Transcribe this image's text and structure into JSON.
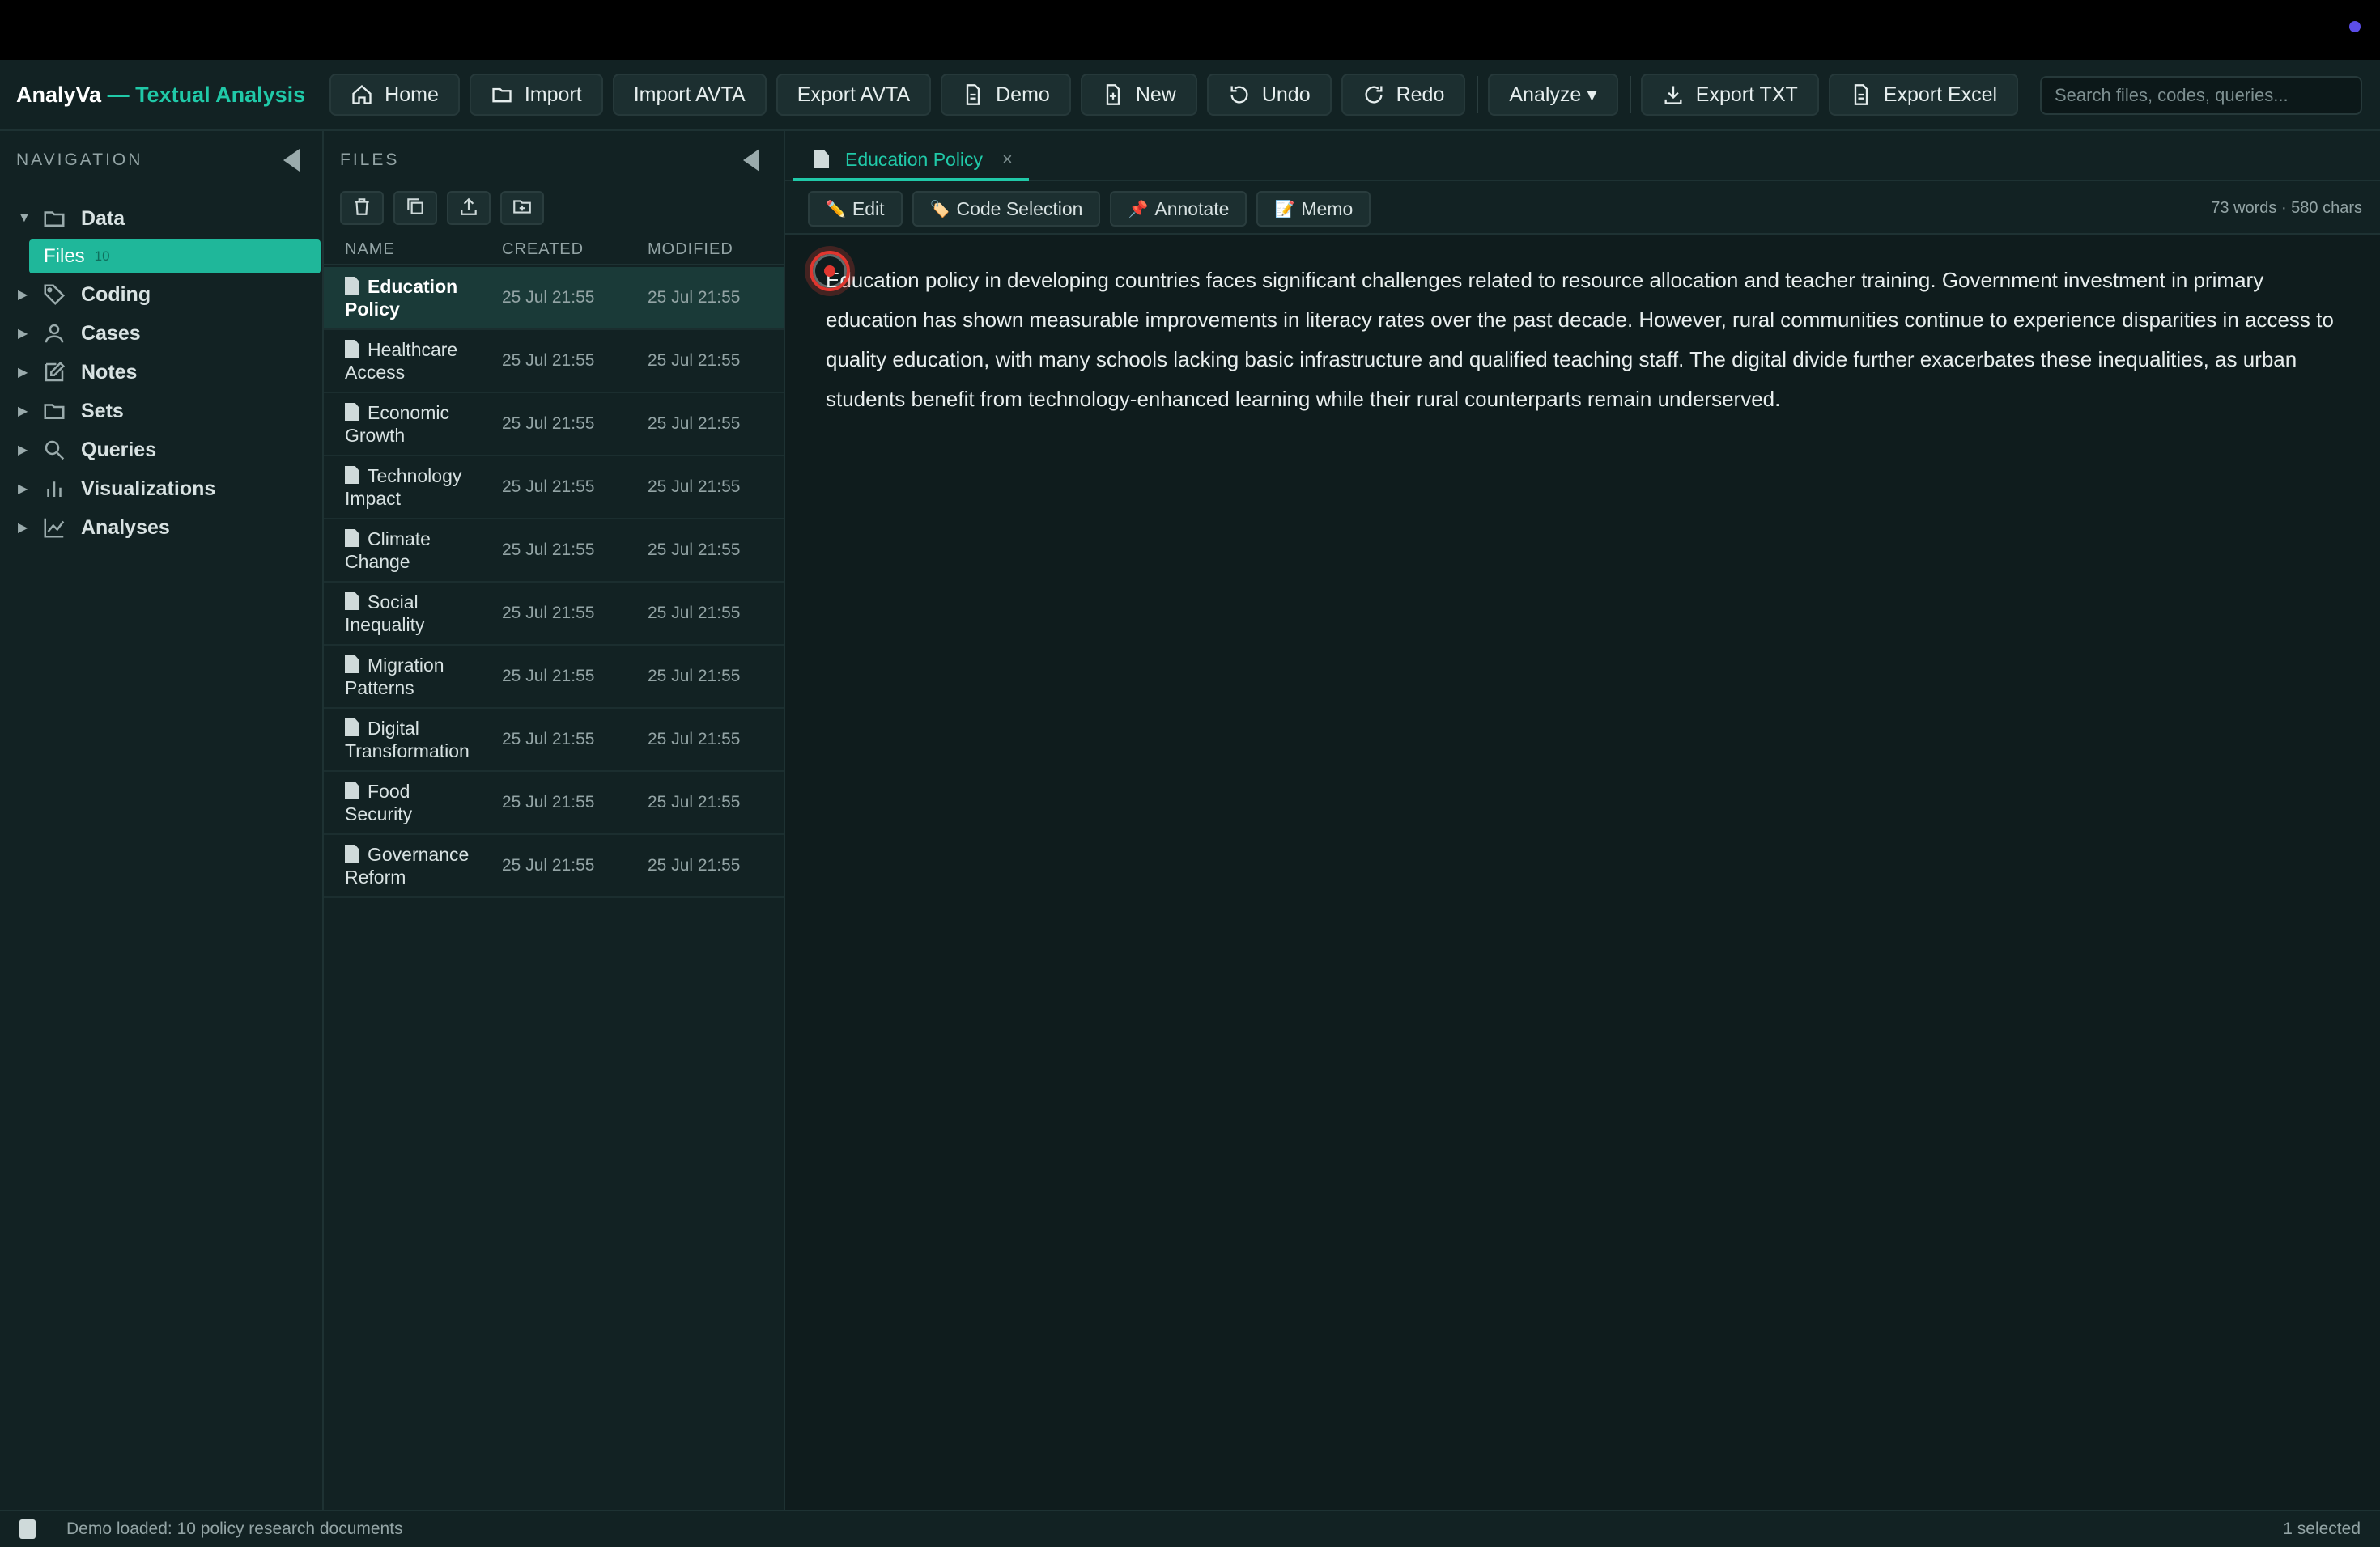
{
  "app": {
    "brand_main": "AnalyVa",
    "brand_sub": " — Textual Analysis"
  },
  "toolbar": {
    "home": "Home",
    "import": "Import",
    "import_avta": "Import AVTA",
    "export_avta": "Export AVTA",
    "demo": "Demo",
    "new": "New",
    "undo": "Undo",
    "redo": "Redo",
    "analyze": "Analyze ▾",
    "export_txt": "Export TXT",
    "export_excel": "Export Excel",
    "search_placeholder": "Search files, codes, queries..."
  },
  "navigation": {
    "title": "NAVIGATION",
    "data_label": "Data",
    "files_label": "Files",
    "files_count": "10",
    "items": [
      "Coding",
      "Cases",
      "Notes",
      "Sets",
      "Queries",
      "Visualizations",
      "Analyses"
    ]
  },
  "files_panel": {
    "title": "FILES",
    "columns": {
      "name": "NAME",
      "created": "CREATED",
      "modified": "MODIFIED"
    },
    "rows": [
      {
        "name": "Education Policy",
        "created": "25 Jul 21:55",
        "modified": "25 Jul 21:55"
      },
      {
        "name": "Healthcare Access",
        "created": "25 Jul 21:55",
        "modified": "25 Jul 21:55"
      },
      {
        "name": "Economic Growth",
        "created": "25 Jul 21:55",
        "modified": "25 Jul 21:55"
      },
      {
        "name": "Technology Impact",
        "created": "25 Jul 21:55",
        "modified": "25 Jul 21:55"
      },
      {
        "name": "Climate Change",
        "created": "25 Jul 21:55",
        "modified": "25 Jul 21:55"
      },
      {
        "name": "Social Inequality",
        "created": "25 Jul 21:55",
        "modified": "25 Jul 21:55"
      },
      {
        "name": "Migration Patterns",
        "created": "25 Jul 21:55",
        "modified": "25 Jul 21:55"
      },
      {
        "name": "Digital Transformation",
        "created": "25 Jul 21:55",
        "modified": "25 Jul 21:55"
      },
      {
        "name": "Food Security",
        "created": "25 Jul 21:55",
        "modified": "25 Jul 21:55"
      },
      {
        "name": "Governance Reform",
        "created": "25 Jul 21:55",
        "modified": "25 Jul 21:55"
      }
    ]
  },
  "document": {
    "tab_title": "Education Policy",
    "tab_close": "×",
    "actions": {
      "edit": "Edit",
      "code_selection": "Code Selection",
      "annotate": "Annotate",
      "memo": "Memo"
    },
    "action_icons": {
      "edit": "✏️",
      "code_selection": "🏷️",
      "annotate": "📌",
      "memo": "📝"
    },
    "stats": "73 words · 580 chars",
    "text": "Education policy in developing countries faces significant challenges related to resource allocation and teacher training. Government investment in primary education has shown measurable improvements in literacy rates over the past decade. However, rural communities continue to experience disparities in access to quality education, with many schools lacking basic infrastructure and qualified teaching staff. The digital divide further exacerbates these inequalities, as urban students benefit from technology-enhanced learning while their rural counterparts remain underserved."
  },
  "status": {
    "left": "Demo loaded: 10 policy research documents",
    "right": "1 selected"
  },
  "colors": {
    "accent": "#20c9a8",
    "background": "#0f1c1d",
    "panel": "#122223",
    "cursor": "#e0362f"
  }
}
